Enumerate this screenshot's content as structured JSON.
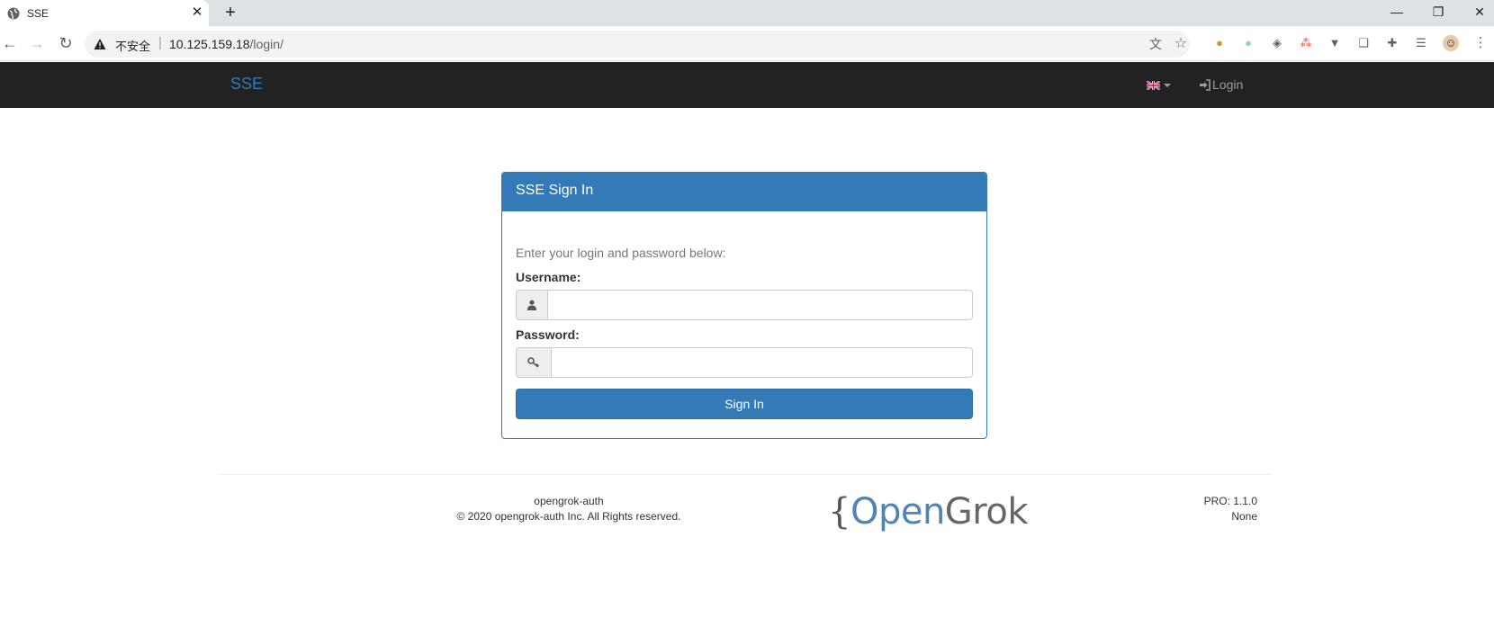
{
  "browser": {
    "tab_title": "SSE",
    "security_label": "不安全",
    "url_host": "10.125.159.18",
    "url_path": "/login/"
  },
  "navbar": {
    "brand": "SSE",
    "login_label": "Login"
  },
  "signin": {
    "heading": "SSE Sign In",
    "intro": "Enter your login and password below:",
    "username_label": "Username:",
    "username_value": "",
    "password_label": "Password:",
    "password_value": "",
    "button_label": "Sign In"
  },
  "footer": {
    "org": "opengrok-auth",
    "copyright": "© 2020 opengrok-auth Inc. All Rights reserved.",
    "logo": {
      "brace": "{",
      "open": "Open",
      "grok": "Grok"
    },
    "version": "PRO: 1.1.0",
    "license": "None"
  },
  "colors": {
    "primary": "#337ab7",
    "navbar_bg": "#222222",
    "nav_text": "#9d9d9d"
  }
}
